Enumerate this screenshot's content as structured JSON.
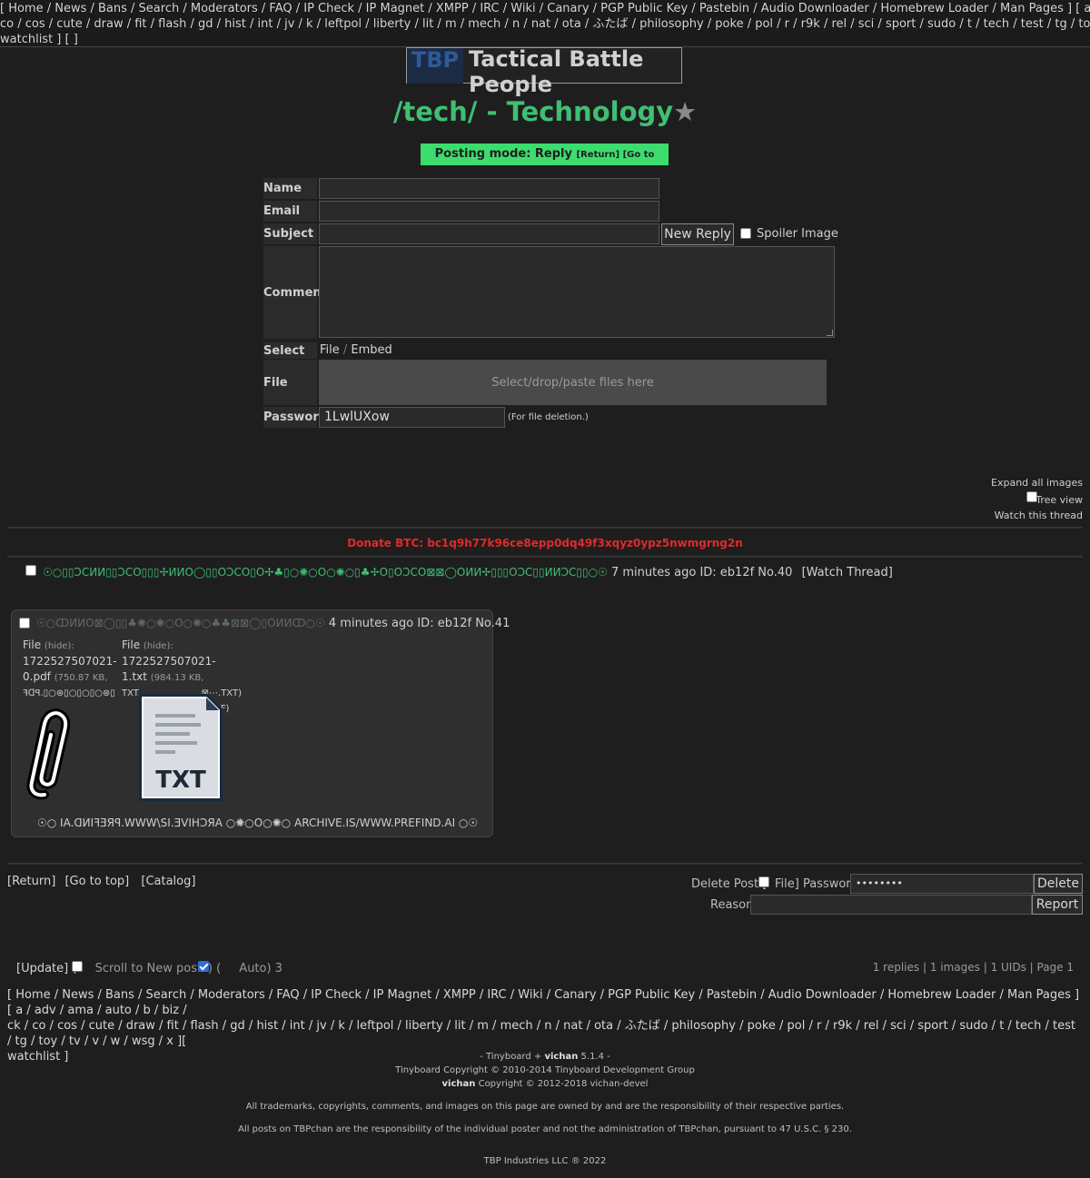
{
  "top_nav": {
    "line1": "[ Home / News / Bans / Search / Moderators / FAQ / IP Check / IP Magnet / XMPP / IRC / Wiki / Canary / PGP Public Key / Pastebin / Audio Downloader / Homebrew Loader / Man Pages ] [ a / adv / ama / auto / b / biz / ck /",
    "line2": "co / cos / cute / draw / fit / flash / gd / hist / int / jv / k / leftpol / liberty / lit / m / mech / n / nat / ota / ふたば / philosophy / poke / pol / r / r9k / rel / sci / sport / sudo / t / tech / test / tg / toy / tv / v / w / wsg / x ][ [Options]",
    "line3": "watchlist ] [ ]"
  },
  "banner": {
    "logo": "TBP",
    "text": "Tactical Battle People"
  },
  "board": {
    "title": "/tech/ - Technology",
    "star": "★"
  },
  "posting_mode": {
    "label": "Posting mode: Reply",
    "return": "[Return]",
    "go_bottom": "[Go to bottom]"
  },
  "form": {
    "name_label": "Name",
    "email_label": "Email",
    "subject_label": "Subject",
    "submit": "New Reply",
    "spoiler_label": "Spoiler Image",
    "comment_label": "Comment",
    "select_label": "Select",
    "select_file": "File",
    "select_sep": " / ",
    "select_embed": "Embed",
    "file_label": "File",
    "dropzone": "Select/drop/paste files here",
    "password_label": "Password",
    "password_value": "1LwlUXow",
    "password_hint": "(For file deletion.)"
  },
  "thread_options": {
    "expand": "Expand all images",
    "tree": "Tree view",
    "watch": "Watch this thread"
  },
  "donate": "Donate BTC: bc1q9h77k96ce8epp0dq49f3xqyz0ypz5nwmgrng2n",
  "op": {
    "name": "☉○▯▯ƆCИИ▯▯ƆCO▯▯▯✢ИИO◯▯▯OƆCO▯O✢♣▯○✺○O○✺○▯♣✢O▯OƆCO⊠⊠◯OИИ✢▯▯▯OƆC▯▯ИИƆC▯▯○☉",
    "meta": "7 minutes ago ID: eb12f No.40",
    "watch": "[Watch Thread]"
  },
  "reply": {
    "name": "☉○ↀИИO⊠◯▯▯♣✺○✺○O○✺○♣♣⊠⊠◯▯OИИↀ○☉",
    "meta": "4 minutes ago ID: eb12f No.41",
    "file1": {
      "label": "File",
      "hide": "(hide):",
      "name": "1722527507021-",
      "name2": "0.pdf",
      "size": "(750.87 KB,",
      "orig": "ꟻᗡꟼ.▯○⊛▯○▯○▯○⊛▯"
    },
    "file2": {
      "label": "File",
      "hide": "(hide):",
      "name": "1722527507021-",
      "name2": "1.txt",
      "size": "(984.13 KB,",
      "orig": "TXT......................⊠⋯.TXT)",
      "orig2": "PDF)"
    },
    "txt_icon": "TXT",
    "body": "☉○ IA.ᗡИIꟻƎЯꟼ.WWW\\SI.ƎVIHƆЯA ○✺○O○✺○ ARCHIVE.IS/WWW.PREFIND.AI ○☉"
  },
  "bottom_nav": {
    "return": "[Return]",
    "top": "[Go to top]",
    "catalog": "[Catalog]"
  },
  "delete": {
    "label": "Delete Post [",
    "file": "File] Password",
    "password": "••••••••",
    "delete_btn": "Delete",
    "reason": "Reason",
    "report_btn": "Report"
  },
  "update": {
    "update": "[Update] (",
    "scroll": "Scroll to New posts) (",
    "auto": "Auto) 3"
  },
  "stats": "1 replies | 1 images | 1 UIDs | Page 1",
  "footer_nav": {
    "line1": "[ Home / News / Bans / Search / Moderators / FAQ / IP Check / IP Magnet / XMPP / IRC / Wiki / Canary / PGP Public Key / Pastebin / Audio Downloader / Homebrew Loader / Man Pages ] [ a / adv / ama / auto / b / biz /",
    "line2": "ck / co / cos / cute / draw / fit / flash / gd / hist / int / jv / k / leftpol / liberty / lit / m / mech / n / nat / ota / ふたば / philosophy / poke / pol / r / r9k / rel / sci / sport / sudo / t / tech / test / tg / toy / tv / v / w / wsg / x ][",
    "line3": "watchlist ]"
  },
  "credits": {
    "line1a": "- Tinyboard + ",
    "line1b": "vichan",
    "line1c": " 5.1.4 -",
    "line2": "Tinyboard Copyright © 2010-2014 Tinyboard Development Group",
    "line3a": "vichan",
    "line3b": " Copyright © 2012-2018 vichan-devel",
    "line4": "All trademarks, copyrights, comments, and images on this page are owned by and are the responsibility of their respective parties.",
    "line5": "All posts on TBPchan are the responsibility of the individual poster and not the administration of TBPchan, pursuant to 47 U.S.C. § 230.",
    "line6": "TBP Industries LLC ® 2022"
  },
  "colors": {
    "accent": "#3fbf74",
    "posting_bar": "#3ddc6e",
    "donate": "#e02a2a",
    "background": "#1e1e1e"
  }
}
